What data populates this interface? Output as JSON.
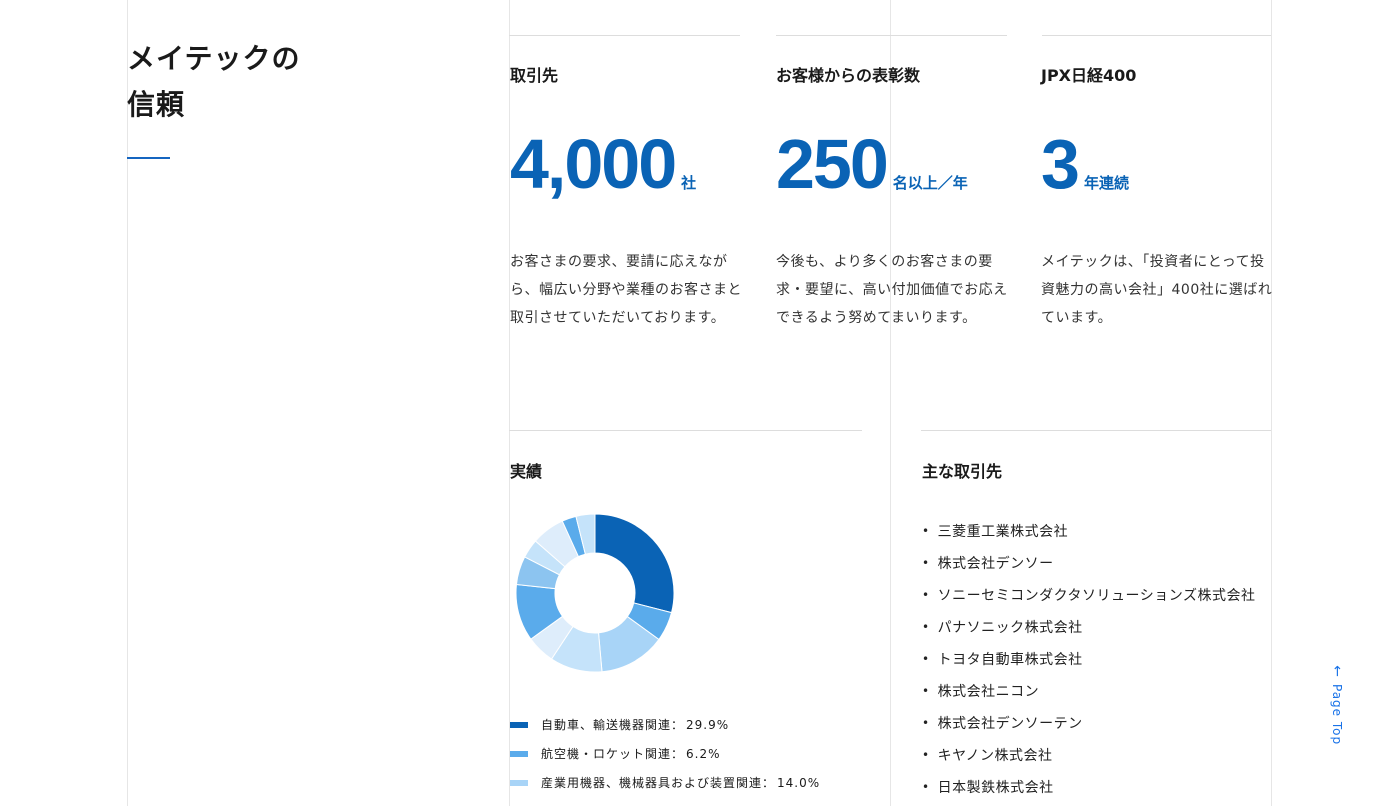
{
  "section": {
    "title_line1": "メイテックの",
    "title_line2": "信頼"
  },
  "stats": [
    {
      "label": "取引先",
      "number": "4,000",
      "unit": "社",
      "desc": "お客さまの要求、要請に応えながら、幅広い分野や業種のお客さまと取引させていただいております。"
    },
    {
      "label": "お客様からの表彰数",
      "number": "250",
      "unit": "名以上／年",
      "desc": "今後も、より多くのお客さまの要求・要望に、高い付加価値でお応えできるよう努めてまいります。"
    },
    {
      "label": "JPX日経400",
      "number": "3",
      "unit": "年連続",
      "desc": "メイテックは、「投資者にとって投資魅力の高い会社」400社に選ばれています。"
    }
  ],
  "performance": {
    "title": "実績",
    "legend": [
      {
        "label": "自動車、輸送機器関連",
        "value": "29.9%",
        "color": "#0a63b5"
      },
      {
        "label": "航空機・ロケット関連",
        "value": "6.2%",
        "color": "#5aabeb"
      },
      {
        "label": "産業用機器、機械器具および装置関連",
        "value": "14.0%",
        "color": "#a8d4f7"
      }
    ]
  },
  "chart_data": {
    "type": "pie",
    "values": [
      29.9,
      6.2,
      14.0,
      11.0,
      6.0,
      12.0,
      6.0,
      4.0,
      7.0,
      3.0,
      4.0
    ],
    "colors": [
      "#0a63b5",
      "#5aabeb",
      "#a8d4f7",
      "#c5e3fa",
      "#deedfb",
      "#5aabeb",
      "#8cc4f0",
      "#c5e3fa",
      "#deedfb",
      "#5aabeb",
      "#c5e3fa"
    ]
  },
  "clients": {
    "title": "主な取引先",
    "items": [
      "三菱重工業株式会社",
      "株式会社デンソー",
      "ソニーセミコンダクタソリューションズ株式会社",
      "パナソニック株式会社",
      "トヨタ自動車株式会社",
      "株式会社ニコン",
      "株式会社デンソーテン",
      "キヤノン株式会社",
      "日本製鉄株式会社"
    ]
  },
  "page_top": {
    "arrow": "←",
    "label": "Page Top"
  }
}
